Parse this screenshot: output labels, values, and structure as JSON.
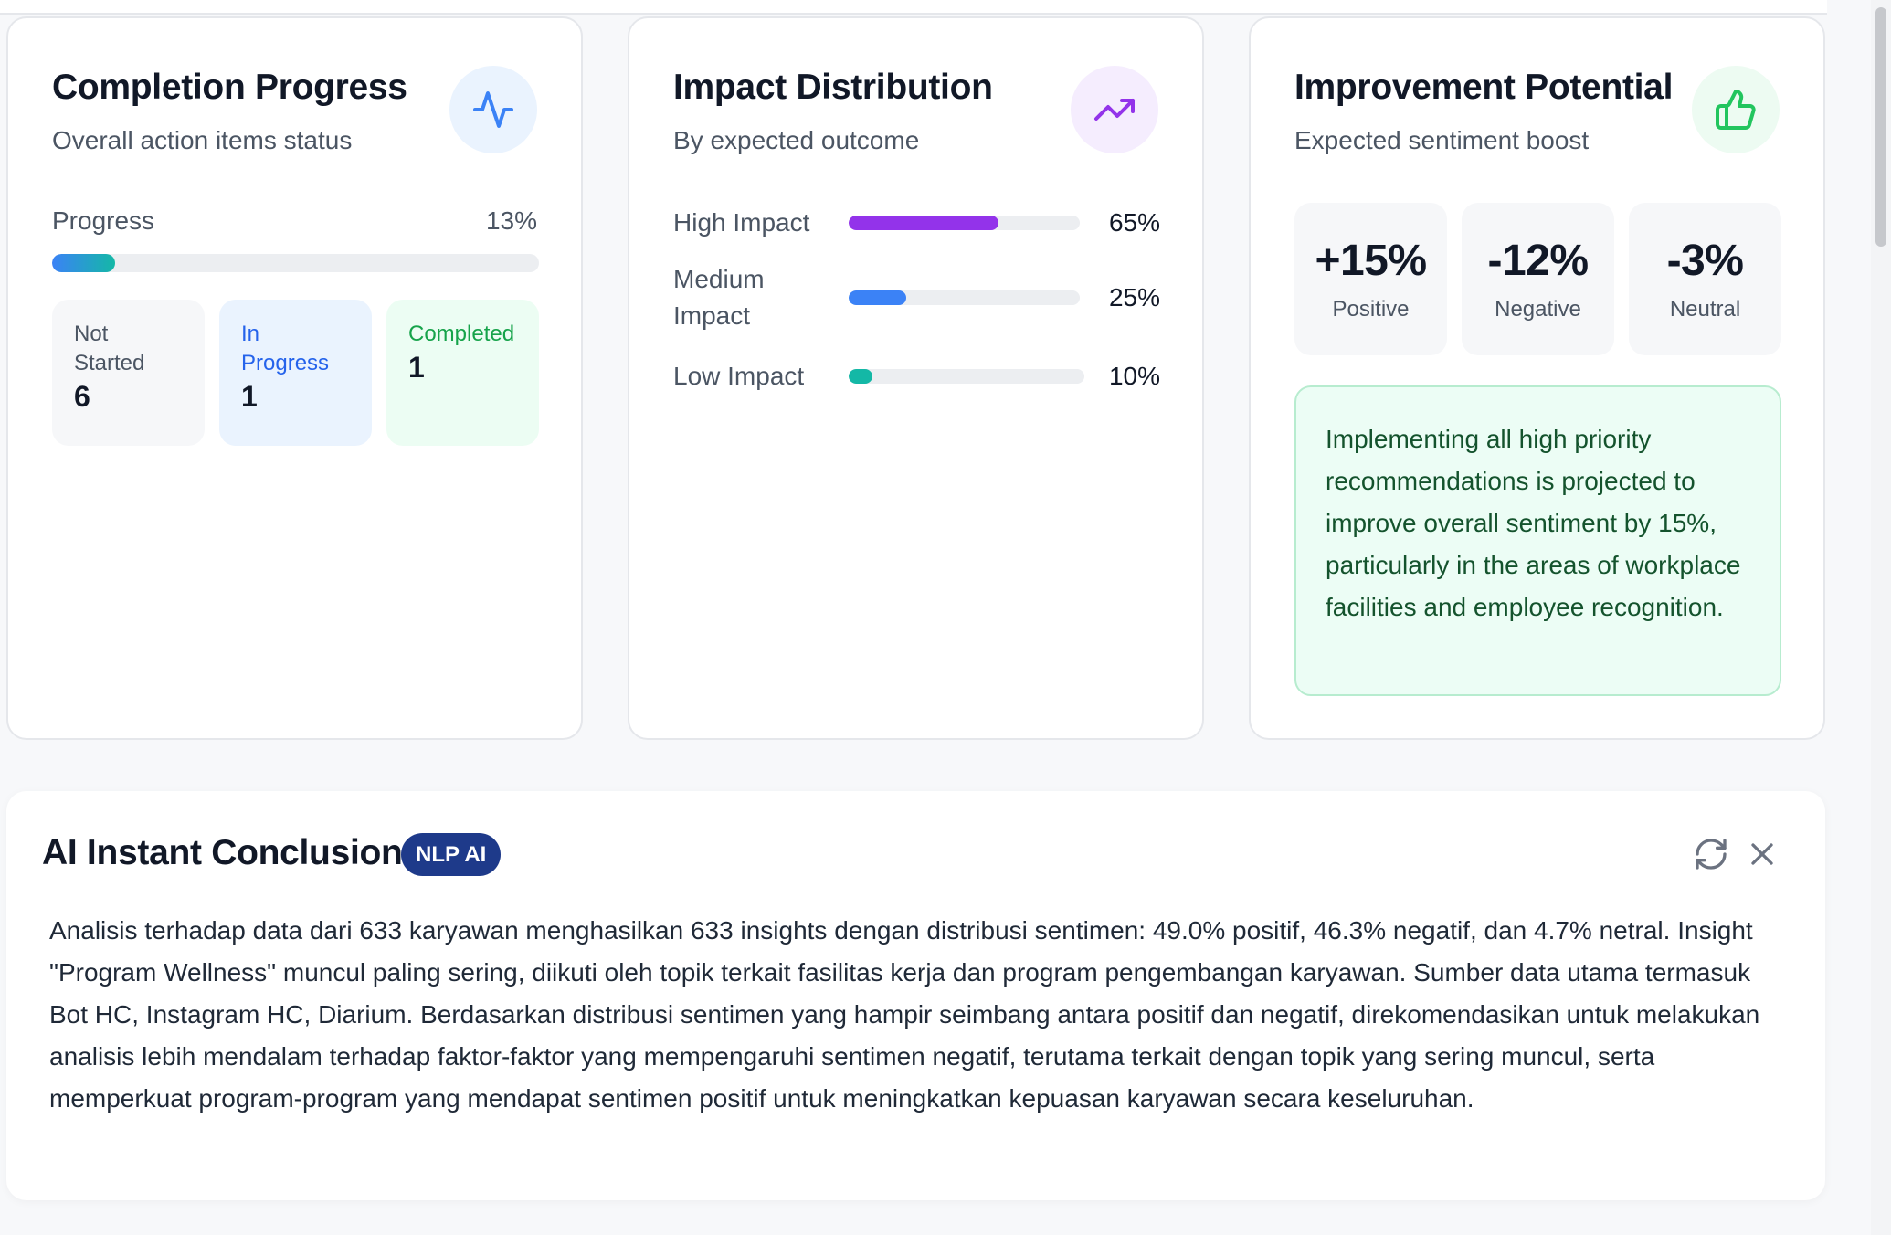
{
  "colors": {
    "progress_gradient": [
      "#3b82f6",
      "#14b8a6"
    ],
    "high_impact": "#9333ea",
    "medium_impact": "#3b82f6",
    "low_impact": "#14b8a6",
    "badge": "#1e3a8a"
  },
  "completion": {
    "title": "Completion Progress",
    "subtitle": "Overall action items status",
    "icon": "activity-icon",
    "progress_label": "Progress",
    "progress_text": "13%",
    "progress_value": 0.13,
    "statuses": [
      {
        "label": "Not Started",
        "count": "6"
      },
      {
        "label": "In Progress",
        "count": "1"
      },
      {
        "label": "Completed",
        "count": "1"
      }
    ]
  },
  "impact": {
    "title": "Impact Distribution",
    "subtitle": "By expected outcome",
    "icon": "trending-up-icon",
    "rows": [
      {
        "label": "High Impact",
        "value": "65%",
        "pct": 65
      },
      {
        "label": "Medium Impact",
        "value": "25%",
        "pct": 25
      },
      {
        "label": "Low Impact",
        "value": "10%",
        "pct": 10
      }
    ]
  },
  "improvement": {
    "title": "Improvement Potential",
    "subtitle": "Expected sentiment boost",
    "icon": "thumbs-up-icon",
    "metrics": [
      {
        "value": "+15%",
        "label": "Positive"
      },
      {
        "value": "-12%",
        "label": "Negative"
      },
      {
        "value": "-3%",
        "label": "Neutral"
      }
    ],
    "note": "Implementing all high priority recommendations is projected to improve overall sentiment by 15%, particularly in the areas of workplace facilities and employee recognition."
  },
  "conclusion": {
    "title": "AI Instant Conclusion",
    "badge": "NLP AI",
    "text": "Analisis terhadap data dari 633 karyawan menghasilkan 633 insights dengan distribusi sentimen: 49.0% positif, 46.3% negatif, dan 4.7% netral. Insight \"Program Wellness\" muncul paling sering, diikuti oleh topik terkait fasilitas kerja dan program pengembangan karyawan. Sumber data utama termasuk Bot HC, Instagram HC, Diarium. Berdasarkan distribusi sentimen yang hampir seimbang antara positif dan negatif, direkomendasikan untuk melakukan analisis lebih mendalam terhadap faktor-faktor yang mempengaruhi sentimen negatif, terutama terkait dengan topik yang sering muncul, serta memperkuat program-program yang mendapat sentimen positif untuk meningkatkan kepuasan karyawan secara keseluruhan."
  }
}
